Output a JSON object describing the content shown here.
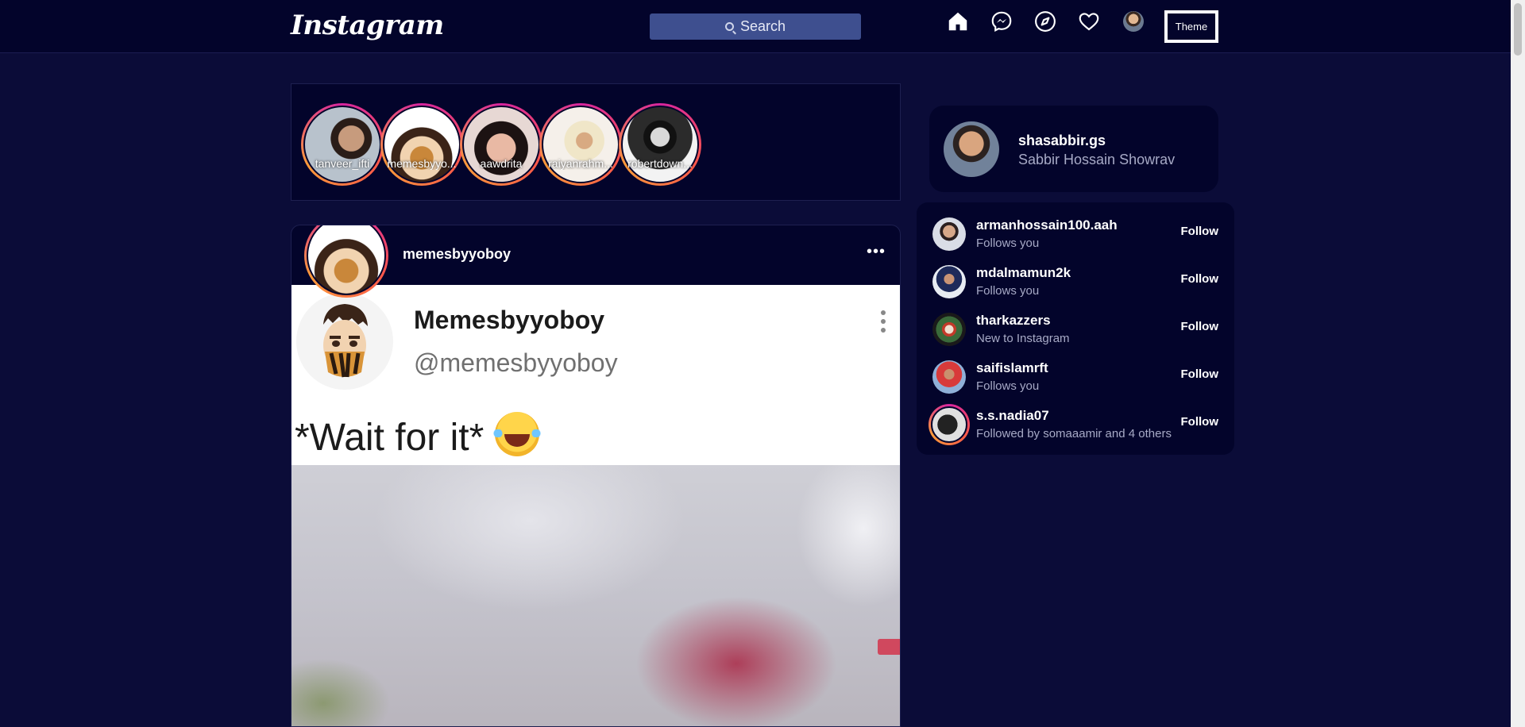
{
  "header": {
    "logo": "Instagram",
    "search_placeholder": "Search",
    "icons": [
      "home-icon",
      "messenger-icon",
      "explore-icon",
      "heart-icon",
      "avatar"
    ],
    "theme_label": "Theme"
  },
  "stories": [
    {
      "username": "tanveer_ifti"
    },
    {
      "username": "memesbyyo..."
    },
    {
      "username": "aawdrita"
    },
    {
      "username": "raiyanrahm..."
    },
    {
      "username": "robertdown..."
    }
  ],
  "post": {
    "username": "memesbyyoboy",
    "tweet": {
      "name": "Memesbyyoboy",
      "handle": "@memesbyyoboy",
      "text": "*Wait for it*"
    }
  },
  "profile": {
    "username": "shasabbir.gs",
    "full_name": "Sabbir Hossain Showrav"
  },
  "suggestions": [
    {
      "username": "armanhossain100.aah",
      "subtitle": "Follows you",
      "action": "Follow"
    },
    {
      "username": "mdalmamun2k",
      "subtitle": "Follows you",
      "action": "Follow"
    },
    {
      "username": "tharkazzers",
      "subtitle": "New to Instagram",
      "action": "Follow"
    },
    {
      "username": "saifislamrft",
      "subtitle": "Follows you",
      "action": "Follow"
    },
    {
      "username": "s.s.nadia07",
      "subtitle": "Followed by somaaamir and 4 others",
      "action": "Follow"
    }
  ],
  "colors": {
    "background": "#0b0c38",
    "panel": "#03042b",
    "search": "#3e4f8f",
    "muted_text": "#a7aac6"
  }
}
